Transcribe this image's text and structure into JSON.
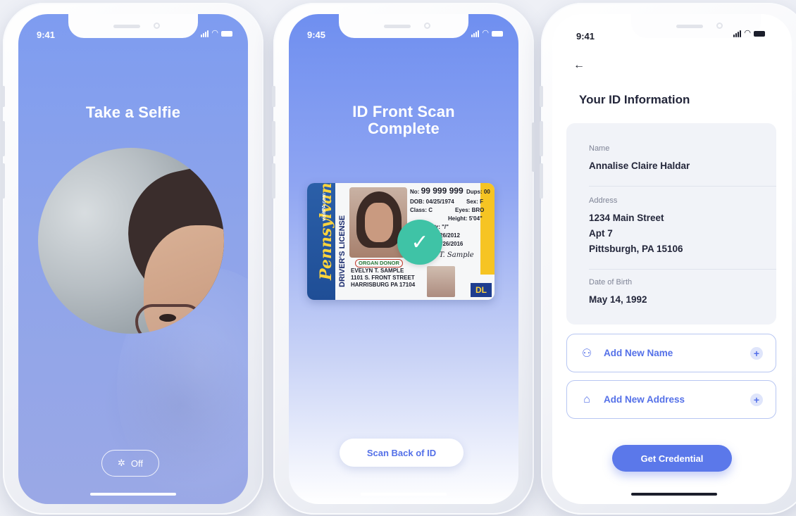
{
  "screens": [
    {
      "time": "9:41",
      "title": "Take a Selfie",
      "flash": {
        "icon": "flash-off-icon",
        "label": "Off"
      }
    },
    {
      "time": "9:45",
      "title_line1": "ID Front Scan",
      "title_line2": "Complete",
      "id_card": {
        "state": "Pennsylvania",
        "site": "visitPA.com",
        "license_type": "DRIVER'S LICENSE",
        "no_label": "No:",
        "number": "99 999 999",
        "dups": "Dups: 00",
        "dob": "DOB: 04/25/1974",
        "sex": "Sex: F",
        "class": "Class: C",
        "eyes": "Eyes: BRO",
        "height": "Height: 5'04\"",
        "restr": "Med Rstr: \"/\"",
        "issued": ": 04/26/2012",
        "expires": "s: 04/26/2016",
        "organ_donor": "ORGAN DONOR",
        "signature": "Evelyn T. Sample",
        "name": "EVELYN T. SAMPLE",
        "street": "1101 S. FRONT STREET",
        "city": "HARRISBURG PA 17104",
        "badge": "DL"
      },
      "check_icon": "checkmark-icon",
      "scan_back_label": "Scan Back of ID"
    },
    {
      "time": "9:41",
      "back_icon": "back-arrow-icon",
      "title": "Your ID Information",
      "fields": [
        {
          "label": "Name",
          "value": "Annalise Claire Haldar"
        },
        {
          "label": "Address",
          "value_lines": [
            "1234 Main Street",
            "Apt 7",
            "Pittsburgh, PA 15106"
          ]
        },
        {
          "label": "Date of Birth",
          "value": "May 14, 1992"
        }
      ],
      "actions": [
        {
          "icon": "person-icon",
          "label": "Add New Name"
        },
        {
          "icon": "home-icon",
          "label": "Add New Address"
        }
      ],
      "cta_label": "Get Credential"
    }
  ],
  "colors": {
    "accent": "#5b78ea",
    "success": "#3fc3a6",
    "selfie_bg": "#8ea4ea",
    "scan_bg_top": "#6f8ff0"
  }
}
